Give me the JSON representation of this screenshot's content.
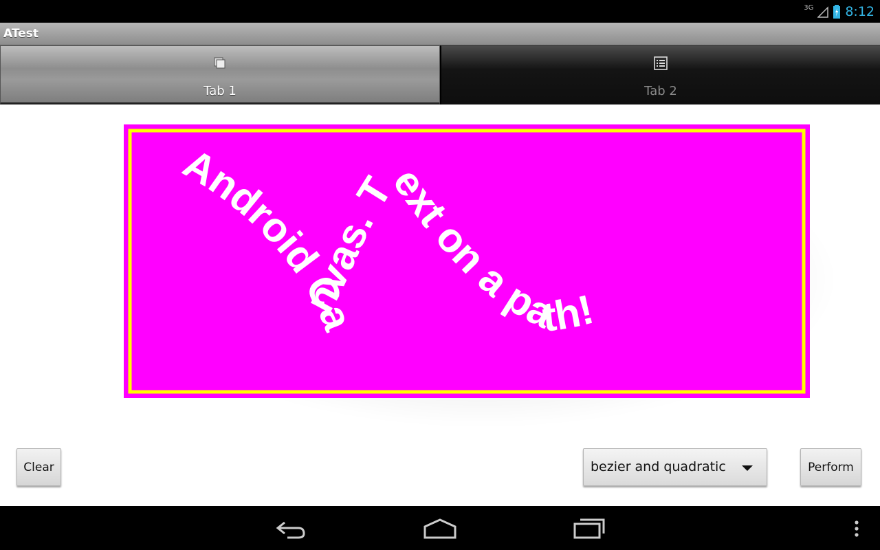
{
  "status_bar": {
    "network": "3G",
    "time": "8:12"
  },
  "app": {
    "title": "ATest"
  },
  "tabs": [
    {
      "label": "Tab 1",
      "icon": "copy-icon",
      "active": true
    },
    {
      "label": "Tab 2",
      "icon": "list-icon",
      "active": false
    }
  ],
  "canvas": {
    "path_text": "Android Canvas. Text on a path!",
    "colors": {
      "background": "#ff00ff",
      "border": "#ffff00",
      "text": "#ffffff"
    }
  },
  "controls": {
    "clear_label": "Clear",
    "spinner_value": "bezier and quadratic",
    "perform_label": "Perform"
  },
  "nav_bar": {
    "icons": [
      "back-icon",
      "home-icon",
      "recents-icon",
      "overflow-menu-icon"
    ]
  }
}
